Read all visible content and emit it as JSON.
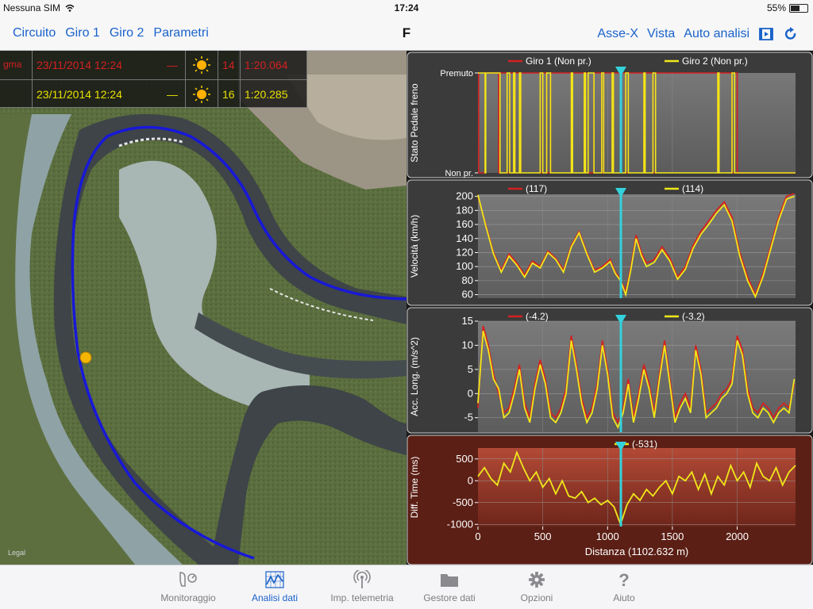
{
  "status": {
    "carrier": "Nessuna SIM",
    "time": "17:24",
    "battery": "55%"
  },
  "nav": {
    "left": [
      "Circuito",
      "Giro 1",
      "Giro 2",
      "Parametri"
    ],
    "title": "F",
    "right": [
      "Asse-X",
      "Vista",
      "Auto analisi"
    ]
  },
  "laps": [
    {
      "prefix": "gma",
      "date": "23/11/2014 12:24",
      "dash": "—",
      "lap": "14",
      "time": "1:20.064",
      "color": "#d42020"
    },
    {
      "prefix": "",
      "date": "23/11/2014 12:24",
      "dash": "—",
      "lap": "16",
      "time": "1:20.285",
      "color": "#e9e000"
    }
  ],
  "map_attribution": "Legal",
  "colors": {
    "lap1": "#d42020",
    "lap2": "#f0e81a",
    "cursor": "#33d2dc",
    "accent": "#1a62c9"
  },
  "chart_data": [
    {
      "type": "line",
      "ylabel": "Stato Pedale freno",
      "ytick_labels": [
        "Premuto",
        "Non pr."
      ],
      "ylim": [
        0,
        1
      ],
      "legend": [
        {
          "label": "Giro 1 (Non pr.)",
          "color": "#d42020"
        },
        {
          "label": "Giro 2 (Non pr.)",
          "color": "#f0e81a"
        }
      ],
      "x": [
        0,
        5,
        55,
        60,
        160,
        170,
        225,
        245,
        275,
        285,
        320,
        330,
        480,
        500,
        530,
        560,
        720,
        730,
        820,
        830,
        850,
        895,
        955,
        970,
        1035,
        1045,
        1140,
        1160,
        1280,
        1290,
        1350,
        1370,
        1850,
        1860,
        1960,
        1980,
        2000,
        2450
      ],
      "series": [
        {
          "name": "Giro 1",
          "values": [
            1,
            0,
            1,
            1,
            0,
            1,
            0,
            1,
            0,
            1,
            0,
            1,
            0,
            1,
            0,
            1,
            0,
            1,
            0,
            1,
            0,
            1,
            0,
            1,
            0,
            1,
            0,
            1,
            0,
            1,
            0,
            1,
            0,
            1,
            0,
            1,
            0,
            0
          ]
        },
        {
          "name": "Giro 2",
          "values": [
            1,
            1,
            0,
            1,
            1,
            0,
            1,
            0,
            1,
            0,
            1,
            0,
            1,
            0,
            1,
            0,
            1,
            0,
            1,
            0,
            1,
            0,
            1,
            0,
            1,
            0,
            1,
            0,
            1,
            0,
            1,
            0,
            1,
            0,
            1,
            0,
            0,
            0
          ]
        }
      ]
    },
    {
      "type": "line",
      "ylabel": "Velocità (km/h)",
      "yticks": [
        60,
        80,
        100,
        120,
        140,
        160,
        180,
        200
      ],
      "ylim": [
        55,
        203
      ],
      "legend": [
        {
          "label": "(117)",
          "color": "#d42020"
        },
        {
          "label": "(114)",
          "color": "#f0e81a"
        }
      ],
      "x": [
        0,
        60,
        120,
        180,
        240,
        300,
        360,
        420,
        480,
        540,
        600,
        660,
        720,
        780,
        840,
        900,
        960,
        1020,
        1060,
        1100,
        1140,
        1180,
        1220,
        1260,
        1300,
        1360,
        1420,
        1480,
        1540,
        1600,
        1660,
        1720,
        1780,
        1840,
        1900,
        1960,
        2020,
        2080,
        2140,
        2200,
        2260,
        2320,
        2380,
        2440
      ],
      "series": [
        {
          "name": "Giro 1",
          "values": [
            200,
            160,
            120,
            95,
            118,
            105,
            88,
            108,
            100,
            122,
            112,
            95,
            130,
            150,
            120,
            95,
            100,
            110,
            92,
            82,
            64,
            100,
            145,
            120,
            105,
            110,
            128,
            112,
            85,
            100,
            130,
            150,
            165,
            180,
            192,
            170,
            120,
            85,
            60,
            90,
            130,
            170,
            200,
            204
          ]
        },
        {
          "name": "Giro 2",
          "values": [
            202,
            158,
            118,
            92,
            115,
            102,
            85,
            105,
            98,
            120,
            110,
            92,
            128,
            148,
            118,
            92,
            98,
            107,
            90,
            80,
            60,
            96,
            140,
            116,
            100,
            106,
            124,
            108,
            82,
            96,
            126,
            146,
            160,
            176,
            188,
            165,
            115,
            80,
            57,
            86,
            126,
            166,
            196,
            200
          ]
        }
      ]
    },
    {
      "type": "line",
      "ylabel": "Acc. Long. (m/s^2)",
      "yticks": [
        -5,
        0,
        5,
        10,
        15
      ],
      "ylim": [
        -8,
        15
      ],
      "legend": [
        {
          "label": "(-4.2)",
          "color": "#d42020"
        },
        {
          "label": "(-3.2)",
          "color": "#f0e81a"
        }
      ],
      "x": [
        0,
        40,
        80,
        120,
        160,
        200,
        240,
        280,
        320,
        360,
        400,
        440,
        480,
        520,
        560,
        600,
        640,
        680,
        720,
        760,
        800,
        840,
        880,
        920,
        960,
        1000,
        1040,
        1080,
        1120,
        1160,
        1200,
        1240,
        1280,
        1320,
        1360,
        1400,
        1440,
        1480,
        1520,
        1560,
        1600,
        1640,
        1680,
        1720,
        1760,
        1800,
        1840,
        1880,
        1920,
        1960,
        2000,
        2040,
        2080,
        2120,
        2160,
        2200,
        2240,
        2280,
        2320,
        2360,
        2400,
        2440
      ],
      "series": [
        {
          "name": "Giro 1",
          "values": [
            -3,
            14,
            10,
            4,
            0,
            -4,
            -3,
            1,
            6,
            -2,
            -5,
            2,
            7,
            3,
            -4,
            -5,
            -3,
            1,
            12,
            6,
            -1,
            -5,
            -3,
            2,
            11,
            5,
            -4,
            -6,
            -3,
            3,
            -5,
            0,
            6,
            2,
            -4,
            4,
            11,
            3,
            -5,
            -2,
            0,
            -3,
            10,
            5,
            -4,
            -3,
            -2,
            0,
            1,
            3,
            12,
            9,
            1,
            -3,
            -4,
            -2,
            -3,
            -5,
            -3,
            -2,
            -3,
            2
          ]
        },
        {
          "name": "Giro 2",
          "values": [
            -2,
            13,
            9,
            3,
            1,
            -5,
            -4,
            0,
            5,
            -3,
            -6,
            1,
            6,
            2,
            -5,
            -6,
            -4,
            0,
            11,
            5,
            -2,
            -6,
            -4,
            1,
            10,
            4,
            -5,
            -7,
            -4,
            2,
            -6,
            -1,
            5,
            1,
            -5,
            3,
            10,
            2,
            -6,
            -3,
            -1,
            -4,
            9,
            4,
            -5,
            -4,
            -3,
            -1,
            0,
            2,
            11,
            8,
            0,
            -4,
            -5,
            -3,
            -4,
            -6,
            -4,
            -3,
            -4,
            3
          ]
        }
      ]
    },
    {
      "type": "line",
      "ylabel": "Diff. Time (ms)",
      "xlabel": "Distanza (1102.632 m)",
      "yticks": [
        -1000,
        -500,
        0,
        500
      ],
      "xticks": [
        0,
        500,
        1000,
        1500,
        2000
      ],
      "ylim": [
        -1050,
        750
      ],
      "xlim": [
        0,
        2450
      ],
      "legend": [
        {
          "label": "(-531)",
          "color": "#f0e81a"
        }
      ],
      "cursor_x": 1102.632,
      "x": [
        0,
        50,
        100,
        150,
        200,
        250,
        300,
        350,
        400,
        450,
        500,
        550,
        600,
        650,
        700,
        750,
        800,
        850,
        900,
        950,
        1000,
        1050,
        1100,
        1150,
        1200,
        1250,
        1300,
        1350,
        1400,
        1450,
        1500,
        1550,
        1600,
        1650,
        1700,
        1750,
        1800,
        1850,
        1900,
        1950,
        2000,
        2050,
        2100,
        2150,
        2200,
        2250,
        2300,
        2350,
        2400,
        2450
      ],
      "series": [
        {
          "name": "Diff",
          "values": [
            100,
            300,
            50,
            -100,
            400,
            200,
            650,
            300,
            0,
            200,
            -150,
            50,
            -300,
            0,
            -350,
            -400,
            -250,
            -500,
            -400,
            -550,
            -450,
            -600,
            -1000,
            -550,
            -300,
            -450,
            -200,
            -350,
            -150,
            0,
            -300,
            100,
            0,
            200,
            -200,
            150,
            -300,
            100,
            -100,
            350,
            0,
            200,
            -150,
            400,
            100,
            0,
            300,
            -100,
            200,
            350
          ]
        }
      ]
    }
  ],
  "tabs": [
    {
      "label": "Monitoraggio",
      "icon": "monitor-icon"
    },
    {
      "label": "Analisi dati",
      "icon": "analysis-chart-icon"
    },
    {
      "label": "Imp. telemetria",
      "icon": "antenna-icon"
    },
    {
      "label": "Gestore dati",
      "icon": "folder-icon"
    },
    {
      "label": "Opzioni",
      "icon": "gear-icon"
    },
    {
      "label": "Aiuto",
      "icon": "help-icon"
    }
  ]
}
